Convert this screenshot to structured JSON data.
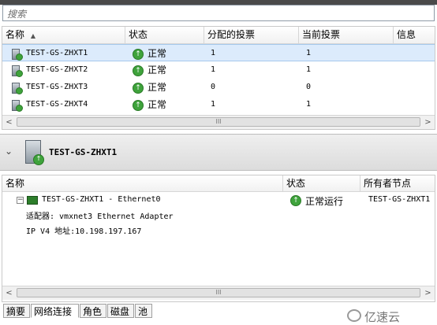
{
  "search": {
    "placeholder": "搜索"
  },
  "table_top": {
    "columns": [
      "名称",
      "状态",
      "分配的投票",
      "当前投票",
      "信息"
    ],
    "rows": [
      {
        "name": "TEST-GS-ZHXT1",
        "status": "正常",
        "assigned": "1",
        "current": "1",
        "selected": true
      },
      {
        "name": "TEST-GS-ZHXT2",
        "status": "正常",
        "assigned": "1",
        "current": "1",
        "selected": false
      },
      {
        "name": "TEST-GS-ZHXT3",
        "status": "正常",
        "assigned": "0",
        "current": "0",
        "selected": false
      },
      {
        "name": "TEST-GS-ZHXT4",
        "status": "正常",
        "assigned": "1",
        "current": "1",
        "selected": false
      }
    ]
  },
  "detail": {
    "title": "TEST-GS-ZHXT1",
    "columns": [
      "名称",
      "状态",
      "所有者节点"
    ],
    "network": {
      "name": "TEST-GS-ZHXT1 - Ethernet0",
      "status": "正常运行",
      "owner": "TEST-GS-ZHXT1",
      "adapter": "适配器: vmxnet3 Ethernet Adapter",
      "ip": "IP V4 地址:10.198.197.167"
    }
  },
  "tabs": [
    "摘要",
    "网络连接",
    "角色",
    "磁盘",
    "池"
  ],
  "active_tab": "网络连接",
  "watermark": "亿速云",
  "icons": {
    "status_ok": "green-up-arrow-icon",
    "server": "server-icon",
    "sort": "sort-ascending-icon",
    "expand": "chevron-down-icon",
    "tree_toggle": "tree-collapse-icon",
    "network_adapter": "network-adapter-icon"
  }
}
